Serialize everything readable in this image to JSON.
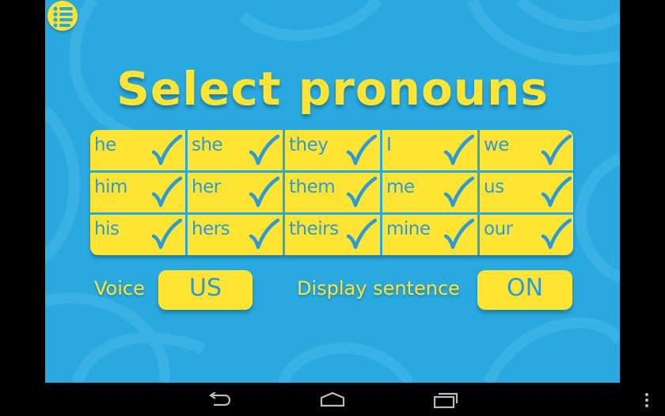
{
  "title": "Select pronouns",
  "colors": {
    "background": "#29a9e0",
    "accent_yellow": "#ffe433",
    "text_blue": "#2c9ad8"
  },
  "menu_icon": "menu-list-icon",
  "pronouns": [
    [
      {
        "word": "he",
        "checked": true
      },
      {
        "word": "she",
        "checked": true
      },
      {
        "word": "they",
        "checked": true
      },
      {
        "word": "I",
        "checked": true
      },
      {
        "word": "we",
        "checked": true
      }
    ],
    [
      {
        "word": "him",
        "checked": true
      },
      {
        "word": "her",
        "checked": true
      },
      {
        "word": "them",
        "checked": true
      },
      {
        "word": "me",
        "checked": true
      },
      {
        "word": "us",
        "checked": true
      }
    ],
    [
      {
        "word": "his",
        "checked": true
      },
      {
        "word": "hers",
        "checked": true
      },
      {
        "word": "theirs",
        "checked": true
      },
      {
        "word": "mine",
        "checked": true
      },
      {
        "word": "our",
        "checked": true
      }
    ]
  ],
  "settings": {
    "voice_label": "Voice",
    "voice_value": "US",
    "display_sentence_label": "Display sentence",
    "display_sentence_value": "ON"
  },
  "navbar": {
    "icons": [
      "back-icon",
      "home-icon",
      "recent-apps-icon",
      "overflow-menu-icon"
    ]
  }
}
